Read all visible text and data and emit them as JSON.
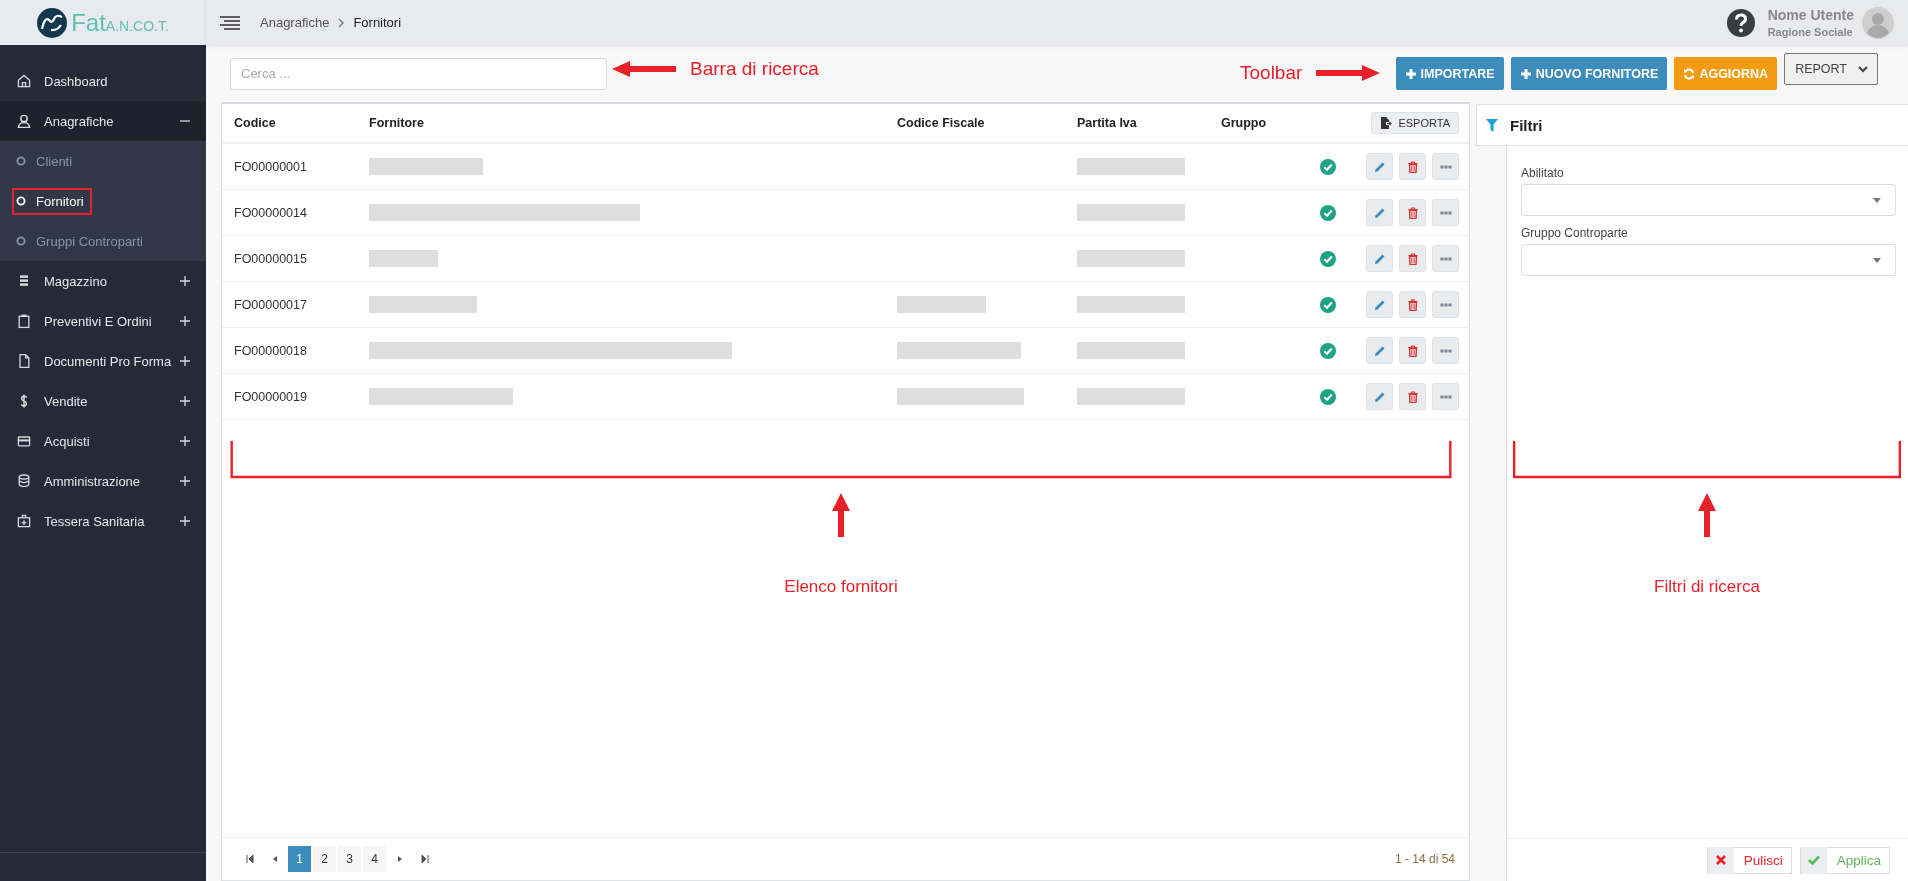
{
  "logo": {
    "part1": "Fat",
    "part2": "A.N.CO.T."
  },
  "breadcrumb": [
    "Anagrafiche",
    "Fornitori"
  ],
  "user": {
    "name": "Nome Utente",
    "company": "Ragione Sociale"
  },
  "sidebar": {
    "items": [
      {
        "label": "Dashboard",
        "kind": "link"
      },
      {
        "label": "Anagrafiche",
        "kind": "group",
        "expanded": true,
        "children": [
          {
            "label": "Clienti",
            "selected": false,
            "boxed": false
          },
          {
            "label": "Fornitori",
            "selected": true,
            "boxed": true
          },
          {
            "label": "Gruppi Controparti",
            "selected": false,
            "boxed": false
          }
        ]
      },
      {
        "label": "Magazzino",
        "kind": "group",
        "expanded": false
      },
      {
        "label": "Preventivi E Ordini",
        "kind": "group",
        "expanded": false
      },
      {
        "label": "Documenti Pro Forma",
        "kind": "group",
        "expanded": false
      },
      {
        "label": "Vendite",
        "kind": "group",
        "expanded": false
      },
      {
        "label": "Acquisti",
        "kind": "group",
        "expanded": false
      },
      {
        "label": "Amministrazione",
        "kind": "group",
        "expanded": false
      },
      {
        "label": "Tessera Sanitaria",
        "kind": "group",
        "expanded": false
      }
    ]
  },
  "search": {
    "placeholder": "Cerca ..."
  },
  "toolbar": [
    {
      "label": "IMPORTARE",
      "kind": "primary"
    },
    {
      "label": "NUOVO FORNITORE",
      "kind": "primary"
    },
    {
      "label": "AGGIORNA",
      "kind": "warning"
    },
    {
      "label": "REPORT",
      "kind": "dropdown"
    }
  ],
  "table": {
    "columns": [
      "Codice",
      "Fornitore",
      "Codice Fiscale",
      "Partita Iva",
      "Gruppo"
    ],
    "export_button": "ESPORTA",
    "rows": [
      {
        "codice": "FO00000001",
        "fornitore_redacted": true,
        "codice_fiscale_redacted": false,
        "partita_iva_redacted": true,
        "enabled": true
      },
      {
        "codice": "FO00000014",
        "fornitore_redacted": true,
        "codice_fiscale_redacted": false,
        "partita_iva_redacted": true,
        "enabled": true
      },
      {
        "codice": "FO00000015",
        "fornitore_redacted": true,
        "codice_fiscale_redacted": false,
        "partita_iva_redacted": true,
        "enabled": true
      },
      {
        "codice": "FO00000017",
        "fornitore_redacted": true,
        "codice_fiscale_redacted": true,
        "partita_iva_redacted": true,
        "enabled": true
      },
      {
        "codice": "FO00000018",
        "fornitore_redacted": true,
        "codice_fiscale_redacted": true,
        "partita_iva_redacted": true,
        "enabled": true
      },
      {
        "codice": "FO00000019",
        "fornitore_redacted": true,
        "codice_fiscale_redacted": true,
        "partita_iva_redacted": true,
        "enabled": true
      }
    ]
  },
  "pagination": {
    "pages": [
      {
        "label": "1",
        "selected": true
      },
      {
        "label": "2",
        "selected": false
      },
      {
        "label": "3",
        "selected": false
      },
      {
        "label": "4",
        "selected": false
      }
    ],
    "summary": "1 - 14 di 54"
  },
  "filters": {
    "title": "Filtri",
    "fields": [
      {
        "label": "Abilitato"
      },
      {
        "label": "Gruppo Controparte"
      }
    ],
    "buttons": [
      {
        "label": "Pulisci",
        "kind": "clear"
      },
      {
        "label": "Applica",
        "kind": "apply"
      }
    ]
  },
  "annotations": [
    {
      "kind": "arrow-left",
      "text": "Barra di ricerca"
    },
    {
      "kind": "arrow-right",
      "text": "Toolbar"
    },
    {
      "kind": "bracket-up",
      "text": "Elenco fornitori"
    },
    {
      "kind": "bracket-up",
      "text": "Filtri di ricerca"
    }
  ]
}
